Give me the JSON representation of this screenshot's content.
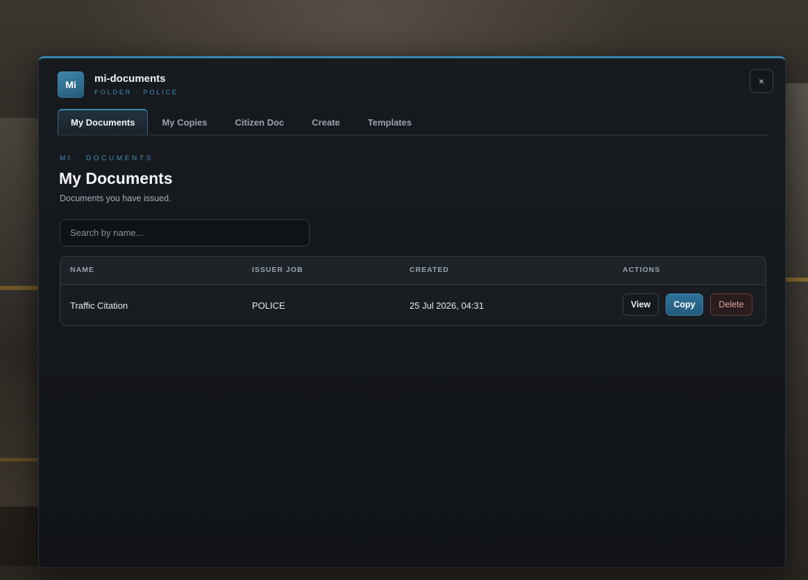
{
  "app": {
    "logo_text": "Mi",
    "title": "mi-documents",
    "subtitle": "FOLDER · POLICE",
    "close_label": "×"
  },
  "tabs": [
    {
      "label": "My Documents",
      "active": true
    },
    {
      "label": "My Copies",
      "active": false
    },
    {
      "label": "Citizen Doc",
      "active": false
    },
    {
      "label": "Create",
      "active": false
    },
    {
      "label": "Templates",
      "active": false
    }
  ],
  "page": {
    "eyebrow": "MI · DOCUMENTS",
    "title": "My Documents",
    "subtitle": "Documents you have issued."
  },
  "search": {
    "placeholder": "Search by name...",
    "value": ""
  },
  "table": {
    "columns": [
      "NAME",
      "ISSUER JOB",
      "CREATED",
      "ACTIONS"
    ],
    "rows": [
      {
        "name": "Traffic Citation",
        "issuer_job": "POLICE",
        "created": "25 Jul 2026, 04:31",
        "actions": {
          "view": "View",
          "copy": "Copy",
          "delete": "Delete"
        }
      }
    ]
  },
  "colors": {
    "accent": "#3a87b0",
    "panel_bg": "#15191e",
    "danger": "#e0a2a2"
  }
}
